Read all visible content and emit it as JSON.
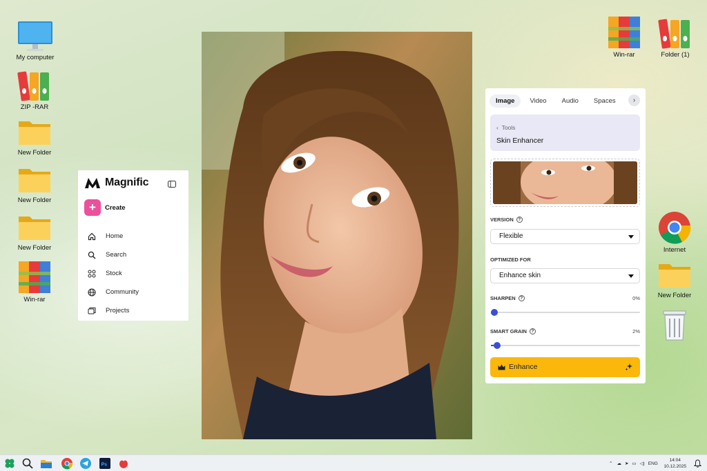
{
  "desktop": {
    "left_icons": [
      {
        "label": "My computer",
        "icon": "monitor-icon"
      },
      {
        "label": "ZIP -RAR",
        "icon": "binders-icon"
      },
      {
        "label": "New Folder",
        "icon": "folder-icon"
      },
      {
        "label": "New Folder",
        "icon": "folder-icon"
      },
      {
        "label": "New Folder",
        "icon": "folder-icon"
      },
      {
        "label": "Win-rar",
        "icon": "winrar-icon"
      }
    ],
    "right_icons": [
      {
        "label": "Win-rar",
        "icon": "winrar-icon"
      },
      {
        "label": "Folder (1)",
        "icon": "binders-icon"
      },
      {
        "label": "Internet",
        "icon": "chrome-icon"
      },
      {
        "label": "New Folder",
        "icon": "folder-icon"
      },
      {
        "label": "",
        "icon": "recycle-bin-icon"
      }
    ]
  },
  "magnific": {
    "brand": "Magnific",
    "create_label": "Create",
    "nav": [
      {
        "label": "Home",
        "icon": "home-icon"
      },
      {
        "label": "Search",
        "icon": "search-icon"
      },
      {
        "label": "Stock",
        "icon": "stock-icon"
      },
      {
        "label": "Community",
        "icon": "globe-icon"
      },
      {
        "label": "Projects",
        "icon": "projects-icon"
      }
    ]
  },
  "panel": {
    "tabs": [
      "Image",
      "Video",
      "Audio",
      "Spaces"
    ],
    "active_tab": "Image",
    "breadcrumb": "Tools",
    "tool_name": "Skin Enhancer",
    "version_label": "VERSION",
    "version_value": "Flexible",
    "optimized_label": "OPTIMIZED FOR",
    "optimized_value": "Enhance skin",
    "sharpen_label": "SHARPEN",
    "sharpen_value": "0%",
    "sharpen_level": 0,
    "grain_label": "SMART GRAIN",
    "grain_value": "2%",
    "grain_level": 0.02,
    "enhance_label": "Enhance",
    "accent_color": "#fbb80a",
    "slider_color": "#3a4fd6"
  },
  "taskbar": {
    "apps": [
      "start-icon",
      "search-icon",
      "file-explorer-icon",
      "chrome-icon",
      "telegram-icon",
      "photoshop-icon",
      "app-icon"
    ],
    "lang": "ENG",
    "time": "14:04",
    "date": "10.12.2025"
  }
}
